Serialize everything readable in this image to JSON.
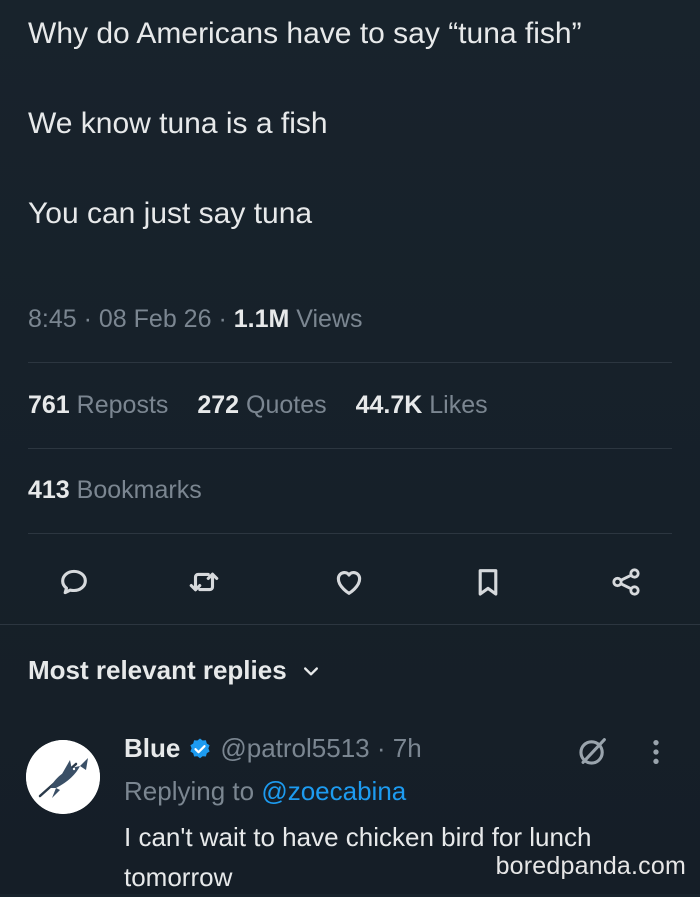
{
  "tweet": {
    "text_line1": "Why do Americans have to say “tuna fish”",
    "text_line2": "We know tuna is a fish",
    "text_line3": "You can just say tuna",
    "time": "8:45",
    "date": "08 Feb 26",
    "views_count": "1.1M",
    "views_label": "Views"
  },
  "stats": {
    "reposts_count": "761",
    "reposts_label": "Reposts",
    "quotes_count": "272",
    "quotes_label": "Quotes",
    "likes_count": "44.7K",
    "likes_label": "Likes",
    "bookmarks_count": "413",
    "bookmarks_label": "Bookmarks"
  },
  "actions": {
    "icons": [
      "reply-icon",
      "repost-icon",
      "like-icon",
      "bookmark-icon",
      "share-icon"
    ]
  },
  "replies": {
    "header": "Most relevant replies",
    "items": [
      {
        "name": "Blue",
        "handle": "@patrol5513",
        "time": "7h",
        "replying_prefix": "Replying to",
        "replying_to": "@zoecabina",
        "text": "I can't wait to have chicken bird for lunch tomorrow"
      }
    ]
  },
  "watermark": "boredpanda.com",
  "colors": {
    "background": "#15202b",
    "text": "#e7e9ea",
    "muted": "#7b8691",
    "accent": "#1d9bf0"
  }
}
